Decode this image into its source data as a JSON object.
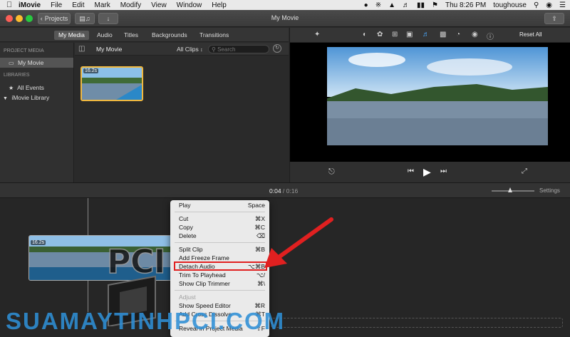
{
  "menubar": {
    "app_name": "iMovie",
    "items": [
      "File",
      "Edit",
      "Mark",
      "Modify",
      "View",
      "Window",
      "Help"
    ],
    "clock": "Thu 8:26 PM",
    "user": "toughouse"
  },
  "titlebar": {
    "back_label": "Projects",
    "title": "My Movie"
  },
  "tabs": [
    "My Media",
    "Audio",
    "Titles",
    "Backgrounds",
    "Transitions"
  ],
  "sidebar": {
    "project_media_header": "PROJECT MEDIA",
    "project_item": "My Movie",
    "libraries_header": "LIBRARIES",
    "all_events": "All Events",
    "library": "iMovie Library"
  },
  "browser": {
    "title": "My Movie",
    "filter": "All Clips",
    "search_placeholder": "Search",
    "clip_duration": "16.2s"
  },
  "viewer": {
    "reset_label": "Reset All"
  },
  "timeline": {
    "current_time": "0:04",
    "separator": "/",
    "total_time": "0:16",
    "settings_label": "Settings",
    "clip_duration": "16.2s"
  },
  "context_menu": [
    {
      "label": "Play",
      "shortcut": "Space",
      "enabled": true
    },
    {
      "label": "Cut",
      "shortcut": "⌘X",
      "enabled": true
    },
    {
      "label": "Copy",
      "shortcut": "⌘C",
      "enabled": true
    },
    {
      "label": "Delete",
      "shortcut": "⌫",
      "enabled": true
    },
    {
      "label": "Split Clip",
      "shortcut": "⌘B",
      "enabled": true
    },
    {
      "label": "Add Freeze Frame",
      "shortcut": "",
      "enabled": true
    },
    {
      "label": "Detach Audio",
      "shortcut": "⌥⌘B",
      "enabled": true
    },
    {
      "label": "Trim To Playhead",
      "shortcut": "⌥/",
      "enabled": true
    },
    {
      "label": "Show Clip Trimmer",
      "shortcut": "⌘\\",
      "enabled": true
    },
    {
      "label": "Adjust",
      "shortcut": "",
      "enabled": false
    },
    {
      "label": "Show Speed Editor",
      "shortcut": "⌘R",
      "enabled": true
    },
    {
      "label": "Add Cross Dissolve",
      "shortcut": "⌘T",
      "enabled": true
    },
    {
      "label": "Reveal in Project Media",
      "shortcut": "⇧F",
      "enabled": true
    }
  ],
  "watermark": {
    "text": "SUAMAYTINHPCI.COM",
    "logo_text": "PCI"
  },
  "colors": {
    "accent": "#2f8fd6",
    "highlight": "#e02020"
  }
}
